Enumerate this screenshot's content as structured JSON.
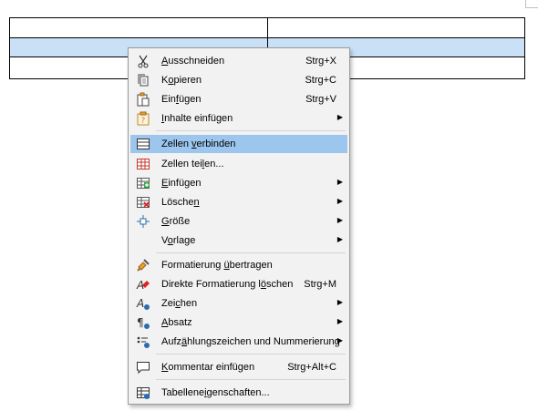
{
  "menu": {
    "items": [
      {
        "label_pre": "",
        "accel": "A",
        "label_post": "usschneiden",
        "shortcut": "Strg+X",
        "icon": "scissors-icon"
      },
      {
        "label_pre": "K",
        "accel": "o",
        "label_post": "pieren",
        "shortcut": "Strg+C",
        "icon": "copy-icon"
      },
      {
        "label_pre": "Ein",
        "accel": "f",
        "label_post": "ügen",
        "shortcut": "Strg+V",
        "icon": "paste-icon"
      },
      {
        "label_pre": "",
        "accel": "I",
        "label_post": "nhalte einfügen",
        "shortcut": "",
        "icon": "paste-special-icon"
      },
      {
        "label_pre": "Zellen ",
        "accel": "v",
        "label_post": "erbinden",
        "shortcut": "",
        "icon": "merge-cells-icon"
      },
      {
        "label_pre": "Zellen tei",
        "accel": "l",
        "label_post": "en...",
        "shortcut": "",
        "icon": "split-cells-icon"
      },
      {
        "label_pre": "",
        "accel": "E",
        "label_post": "infügen",
        "shortcut": "",
        "icon": "insert-table-icon"
      },
      {
        "label_pre": "Lösche",
        "accel": "n",
        "label_post": "",
        "shortcut": "",
        "icon": "delete-table-icon"
      },
      {
        "label_pre": "",
        "accel": "G",
        "label_post": "röße",
        "shortcut": "",
        "icon": "size-icon"
      },
      {
        "label_pre": "V",
        "accel": "o",
        "label_post": "rlage",
        "shortcut": "",
        "icon": "style-icon"
      },
      {
        "label_pre": "Formatierung ",
        "accel": "ü",
        "label_post": "bertragen",
        "shortcut": "",
        "icon": "paintbrush-icon"
      },
      {
        "label_pre": "Direkte Formatierung l",
        "accel": "ö",
        "label_post": "schen",
        "shortcut": "Strg+M",
        "icon": "clear-format-icon"
      },
      {
        "label_pre": "Zei",
        "accel": "c",
        "label_post": "hen",
        "shortcut": "",
        "icon": "character-icon"
      },
      {
        "label_pre": "",
        "accel": "A",
        "label_post": "bsatz",
        "shortcut": "",
        "icon": "paragraph-icon"
      },
      {
        "label_pre": "Aufz",
        "accel": "ä",
        "label_post": "hlungszeichen und Nummerierung",
        "shortcut": "",
        "icon": "bullets-icon"
      },
      {
        "label_pre": "",
        "accel": "K",
        "label_post": "ommentar einfügen",
        "shortcut": "Strg+Alt+C",
        "icon": "comment-icon"
      },
      {
        "label_pre": "Tabellene",
        "accel": "i",
        "label_post": "genschaften...",
        "shortcut": "",
        "icon": "table-properties-icon"
      }
    ]
  }
}
